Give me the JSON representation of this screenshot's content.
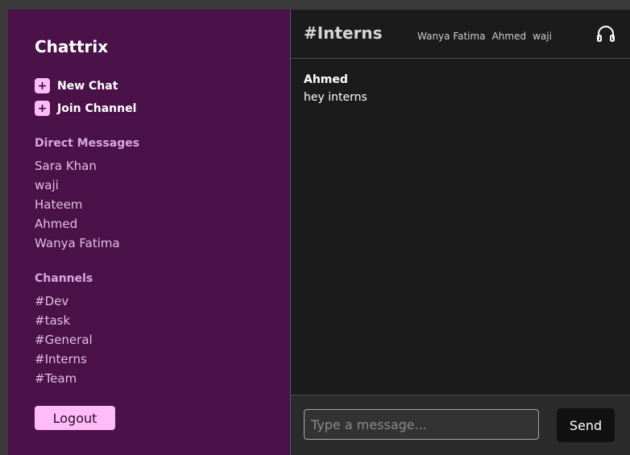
{
  "sidebar": {
    "brand": "Chattrix",
    "actions": [
      {
        "icon": "plus-icon",
        "label": "New Chat"
      },
      {
        "icon": "plus-icon",
        "label": "Join Channel"
      }
    ],
    "direct_messages_title": "Direct Messages",
    "direct_messages": [
      "Sara Khan",
      "waji",
      "Hateem",
      "Ahmed",
      "Wanya Fatima"
    ],
    "channels_title": "Channels",
    "channels": [
      "#Dev",
      "#task",
      "#General",
      "#Interns",
      "#Team"
    ],
    "logout_label": "Logout"
  },
  "header": {
    "channel_name": "#Interns",
    "members": [
      "Wanya Fatima",
      "Ahmed",
      "waji"
    ],
    "call_icon": "headset-icon"
  },
  "messages": [
    {
      "author": "Ahmed",
      "text": "hey interns"
    }
  ],
  "composer": {
    "placeholder": "Type a message...",
    "value": "",
    "send_label": "Send"
  },
  "colors": {
    "sidebar_bg": "#4a1248",
    "accent": "#ffbcf8",
    "main_bg": "#1b1b1b"
  }
}
